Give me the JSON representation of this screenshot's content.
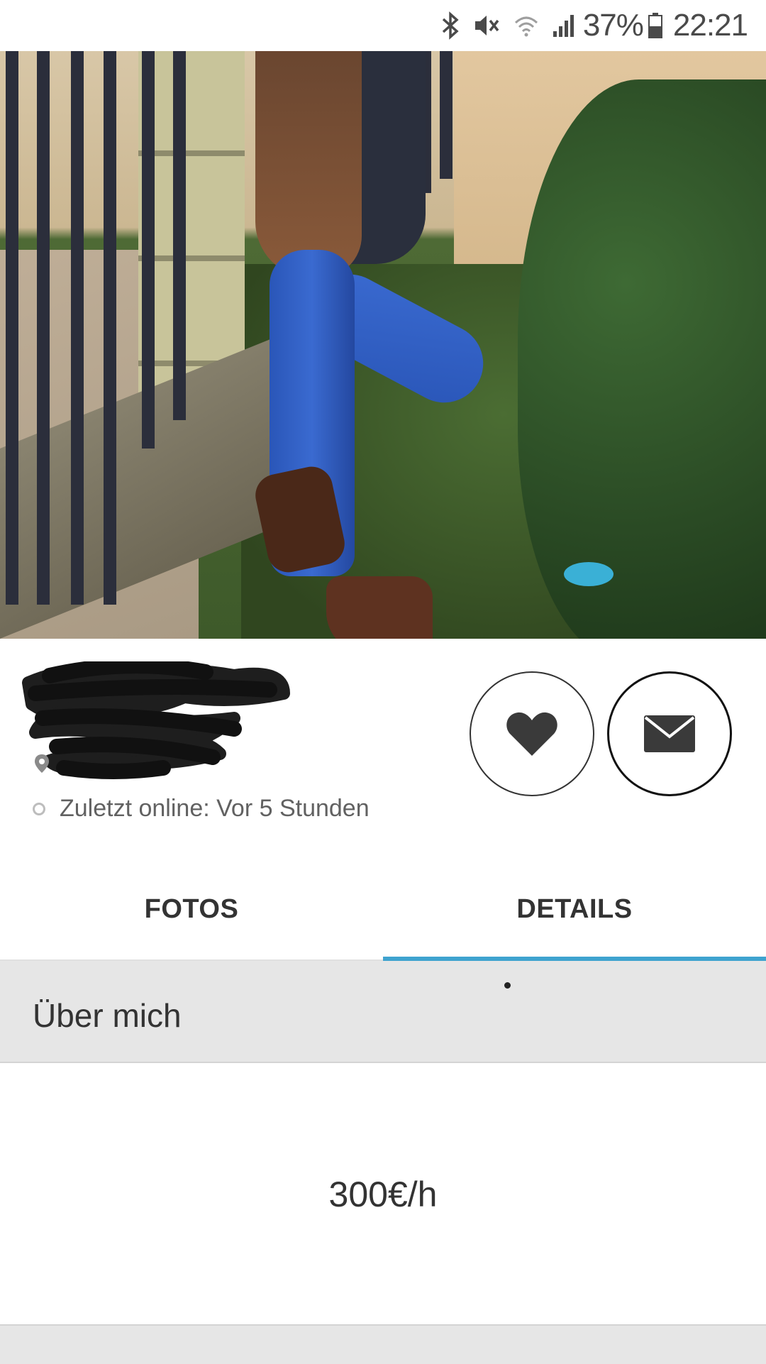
{
  "status_bar": {
    "icons": [
      "bluetooth-icon",
      "mute-icon",
      "wifi-icon",
      "signal-icon",
      "battery-icon"
    ],
    "battery_percent": "37%",
    "time": "22:21"
  },
  "profile": {
    "name": "",
    "location": "",
    "last_online": "Zuletzt online: Vor 5 Stunden"
  },
  "actions": {
    "like_icon": "heart-icon",
    "message_icon": "envelope-icon"
  },
  "tabs": [
    {
      "label": "FOTOS",
      "active": false
    },
    {
      "label": "DETAILS",
      "active": true
    }
  ],
  "details": {
    "section_title": "Über mich",
    "about_text": "300€/h"
  },
  "colors": {
    "tab_indicator": "#3fa3cf",
    "section_bg": "#e6e6e6",
    "text": "#333333"
  }
}
